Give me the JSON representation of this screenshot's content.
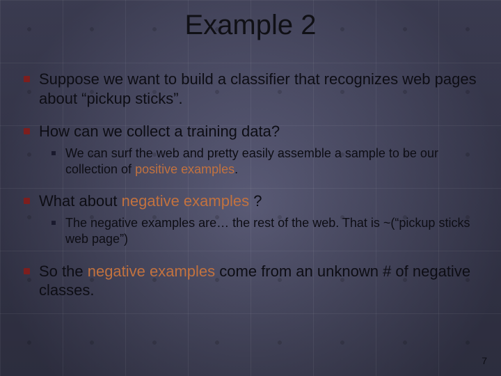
{
  "title": "Example 2",
  "bullets": {
    "b1": "Suppose we want to build a classifier that recognizes web pages about “pickup sticks”.",
    "b2": "How can we collect a training data?",
    "b2_s1_a": "We can surf the web and pretty easily assemble a sample to be our collection of ",
    "b2_s1_pos": "positive examples",
    "b2_s1_b": ".",
    "b3_a": "What about ",
    "b3_neg": "negative examples",
    "b3_b": " ?",
    "b3_s1": "The negative examples are… the rest of the web. That is ~(“pickup sticks web page”)",
    "b4_a": "So the ",
    "b4_neg": "negative examples",
    "b4_b": " come from an unknown # of negative classes."
  },
  "page_number": "7"
}
